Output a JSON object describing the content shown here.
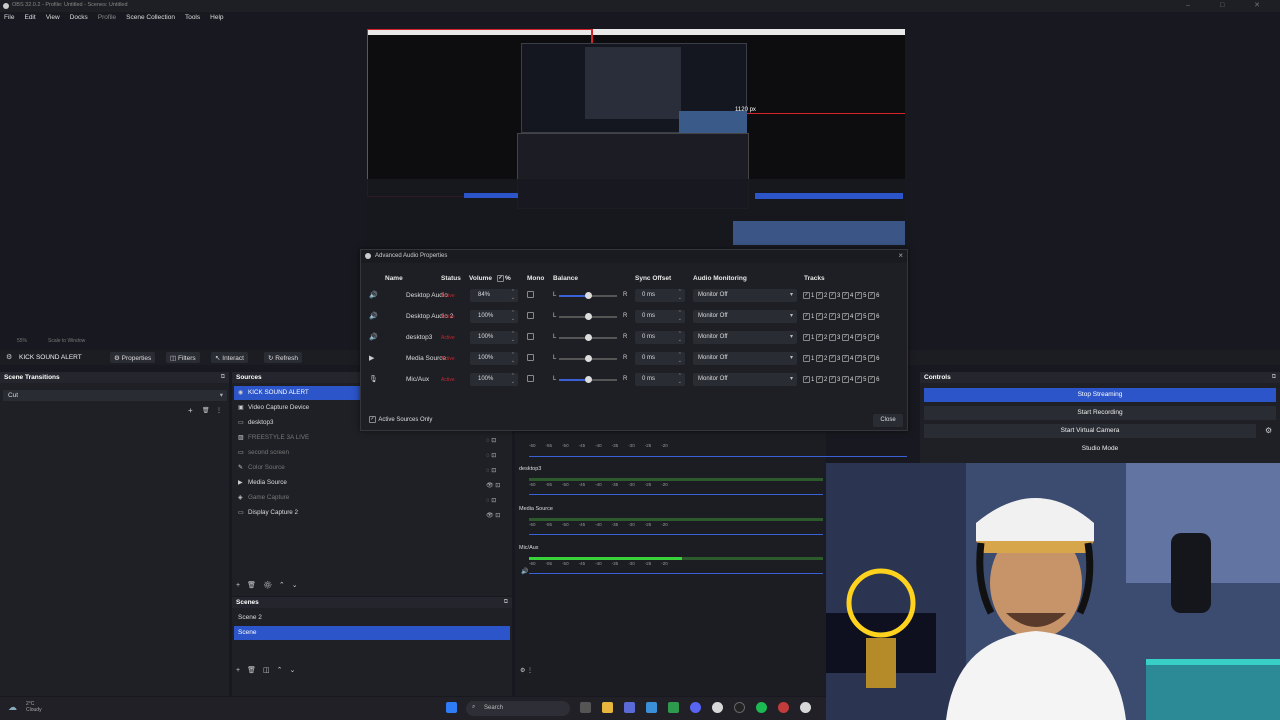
{
  "window": {
    "title": "OBS 32.0.2 - Profile: Untitled - Scenes: Untitled"
  },
  "menu": [
    "File",
    "Edit",
    "View",
    "Docks",
    "Profile",
    "Scene Collection",
    "Tools",
    "Help"
  ],
  "preview": {
    "measure_label": "1120 px",
    "zoom_percent": "55%",
    "zoom_mode": "Scale to Window"
  },
  "source_toolbar": {
    "selected": "KICK SOUND ALERT",
    "properties": "Properties",
    "filters": "Filters",
    "interact": "Interact",
    "refresh": "Refresh"
  },
  "scene_transitions": {
    "title": "Scene Transitions",
    "value": "Cut"
  },
  "sources": {
    "title": "Sources",
    "items": [
      {
        "label": "KICK SOUND ALERT",
        "icon": "browser-icon",
        "selected": true
      },
      {
        "label": "Video Capture Device",
        "icon": "camera-icon"
      },
      {
        "label": "desktop3",
        "icon": "monitor-icon"
      },
      {
        "label": "FREESTYLE 3A LIVE",
        "icon": "image-icon",
        "dim": true
      },
      {
        "label": "second screen",
        "icon": "monitor-icon",
        "dim": true
      },
      {
        "label": "Color Source",
        "icon": "color-icon",
        "dim": true
      },
      {
        "label": "Media Source",
        "icon": "play-icon"
      },
      {
        "label": "Game Capture",
        "icon": "gamepad-icon",
        "dim": true
      },
      {
        "label": "Display Capture 2",
        "icon": "monitor-icon"
      }
    ]
  },
  "scenes": {
    "title": "Scenes",
    "items": [
      "Scene 2",
      "Scene"
    ],
    "selected_index": 1
  },
  "controls": {
    "title": "Controls",
    "buttons": [
      "Stop Streaming",
      "Start Recording",
      "Start Virtual Camera",
      "Studio Mode"
    ]
  },
  "mixer": {
    "channels": [
      {
        "name": "desktop3"
      },
      {
        "name": "Media Source"
      },
      {
        "name": "Mic/Aux",
        "level": 0.52
      }
    ],
    "scale": [
      "-60",
      "-55",
      "-50",
      "-45",
      "-40",
      "-35",
      "-30",
      "-25",
      "-20",
      "-15",
      "-10",
      "-5",
      "0"
    ]
  },
  "advanced_audio": {
    "title": "Advanced Audio Properties",
    "columns": {
      "name": "Name",
      "status": "Status",
      "volume": "Volume",
      "percent": "%",
      "mono": "Mono",
      "balance": "Balance",
      "sync": "Sync Offset",
      "monitoring": "Audio Monitoring",
      "tracks": "Tracks"
    },
    "balance_left": "L",
    "balance_right": "R",
    "rows": [
      {
        "name": "Desktop Audio",
        "status": "Active",
        "volume": "84%",
        "sync": "0 ms",
        "monitoring": "Monitor Off",
        "balance": 0.5,
        "balance_active": true
      },
      {
        "name": "Desktop Audio 2",
        "status": "Active",
        "volume": "100%",
        "sync": "0 ms",
        "monitoring": "Monitor Off",
        "balance": 0.5
      },
      {
        "name": "desktop3",
        "status": "Active",
        "volume": "100%",
        "sync": "0 ms",
        "monitoring": "Monitor Off",
        "balance": 0.5
      },
      {
        "name": "Media Source",
        "status": "Active",
        "volume": "100%",
        "sync": "0 ms",
        "monitoring": "Monitor Off",
        "balance": 0.5
      },
      {
        "name": "Mic/Aux",
        "status": "Active",
        "volume": "100%",
        "sync": "0 ms",
        "monitoring": "Monitor Off",
        "balance": 0.5,
        "balance_active": true
      }
    ],
    "tracks": [
      "1",
      "2",
      "3",
      "4",
      "5",
      "6"
    ],
    "active_sources_only": "Active Sources Only",
    "close": "Close"
  },
  "taskbar": {
    "weather_temp": "2°C",
    "weather_desc": "Cloudy",
    "search": "Search"
  },
  "colors": {
    "accent": "#2b55c9",
    "status_red": "#c0282d",
    "meter_green": "#3ad23a",
    "guide_red": "#d4242a"
  }
}
